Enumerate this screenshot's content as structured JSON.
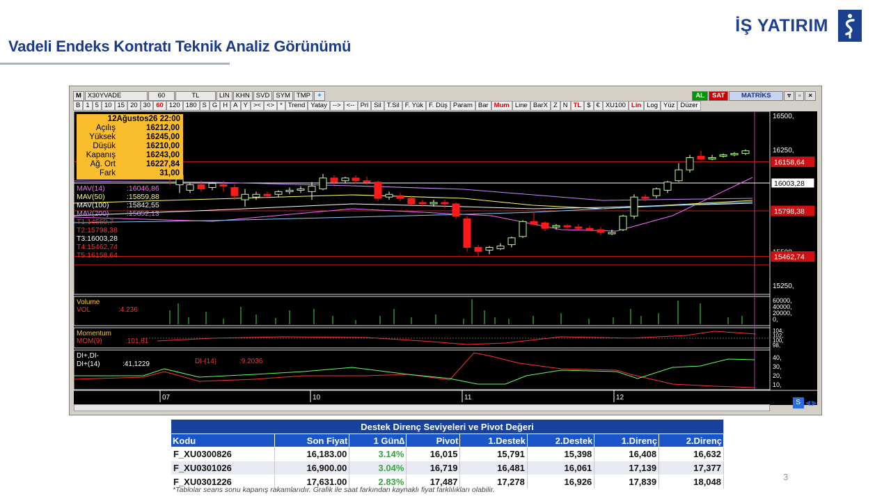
{
  "header": {
    "page_title": "Vadeli Endeks Kontratı Teknik Analiz Görünümü",
    "logo_text": "İŞ YATIRIM",
    "colors": {
      "brand": "#1d3f8f"
    }
  },
  "terminal": {
    "toolbar_top": [
      "M",
      "X30YVADE",
      "60",
      "TL",
      "LIN",
      "KHN",
      "SVD",
      "SYM",
      "TMP"
    ],
    "toolbar_right": [
      "AL",
      "SAT",
      "MATRİKS"
    ],
    "toolbar_bottom": [
      "B",
      "1",
      "5",
      "10",
      "15",
      "20",
      "30",
      "60",
      "120",
      "180",
      "S",
      "G",
      "H",
      "A",
      "Y",
      "><",
      "<>",
      "*",
      "Trend",
      "Yatay",
      "-->",
      "<--",
      "Prl",
      "Sil",
      "T.Sil",
      "F. Yük",
      "F. Düş",
      "Param",
      "Bar",
      "Mum",
      "Line",
      "BarX",
      "Z",
      "N",
      "TL",
      "$",
      "€",
      "XU100",
      "Lin",
      "Log",
      "Yüz",
      "Düzer"
    ],
    "active_period": "60",
    "info": {
      "date": "12Ağustos26 22:00",
      "rows": [
        {
          "label": "Açılış",
          "value": "16212,00"
        },
        {
          "label": "Yüksek",
          "value": "16245,00"
        },
        {
          "label": "Düşük",
          "value": "16210,00"
        },
        {
          "label": "Kapanış",
          "value": "16243,00"
        },
        {
          "label": "Ağ. Ort",
          "value": "16227,84"
        },
        {
          "label": "Fark",
          "value": "31,00"
        }
      ]
    },
    "legend_main": [
      {
        "text": "MAV(14)",
        "value": ":16046,86",
        "color": "#ff66ff"
      },
      {
        "text": "MAV(50)",
        "value": ":15859,88",
        "color": "#ffff66"
      },
      {
        "text": "MAV(100)",
        "value": ":15842,55",
        "color": "#ffffff"
      },
      {
        "text": "MAV(200)",
        "value": ":15852,13",
        "color": "#cc88ff"
      },
      {
        "text": "T1:14550,7",
        "value": "",
        "color": "#ff3333"
      },
      {
        "text": "T2:15798,38",
        "value": "",
        "color": "#ff3333"
      },
      {
        "text": "T3:16003,28",
        "value": "",
        "color": "#ffffff"
      },
      {
        "text": "T4:15462,74",
        "value": "",
        "color": "#ff3333"
      },
      {
        "text": "T5:16158,64",
        "value": "",
        "color": "#ff3333"
      }
    ],
    "price_axis": [
      "16500,",
      "16250,",
      "15500,",
      "15250,"
    ],
    "price_tags": [
      {
        "text": "16158,64",
        "kind": "red"
      },
      {
        "text": "16003,28",
        "kind": "white"
      },
      {
        "text": "15798,38",
        "kind": "red"
      },
      {
        "text": "15462,74",
        "kind": "red"
      }
    ],
    "volume": {
      "title": "Volume",
      "label": "VOL",
      "value": ":4.236",
      "axis": [
        "60000,",
        "40000,",
        "20000,",
        "0,"
      ]
    },
    "momentum": {
      "title": "Momentum",
      "label": "MOM(9)",
      "value": ":101,81",
      "axis": [
        "104,",
        "102,",
        "100,",
        "98,"
      ]
    },
    "dmi": {
      "title": "DI+,DI-",
      "plus_label": "DI+(14)",
      "plus_value": ":41,1229",
      "minus_label": "DI-(14)",
      "minus_value": ":9,2036",
      "axis": [
        "40,",
        "30,",
        "20,",
        "10,"
      ]
    },
    "x_ticks": [
      "07",
      "10",
      "11",
      "12"
    ]
  },
  "table": {
    "caption": "Destek Direnç Seviyeleri ve Pivot Değeri",
    "columns": [
      "Kodu",
      "Son Fiyat",
      "1 Gün∆",
      "Pivot",
      "1.Destek",
      "2.Destek",
      "1.Direnç",
      "2.Direnç"
    ],
    "rows": [
      [
        "F_XU0300826",
        "16,183.00",
        "3.14%",
        "16,015",
        "15,791",
        "15,398",
        "16,408",
        "16,632"
      ],
      [
        "F_XU0301026",
        "16,900.00",
        "3.04%",
        "16,719",
        "16,481",
        "16,061",
        "17,139",
        "17,377"
      ],
      [
        "F_XU0301226",
        "17,631.00",
        "2.83%",
        "17,487",
        "17,278",
        "16,926",
        "17,839",
        "18,048"
      ]
    ]
  },
  "footer": {
    "note": "*Tablolar seans sonu kapanış rakamlarıdır. Grafik ile saat farkından kaynaklı fiyat farklılıkları olabilir.",
    "page_number": "3"
  }
}
